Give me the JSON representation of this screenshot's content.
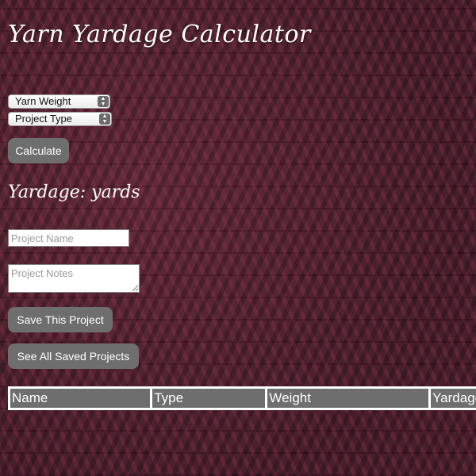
{
  "page": {
    "title": "Yarn Yardage Calculator"
  },
  "form": {
    "yarn_weight_select": {
      "selected": "Yarn Weight"
    },
    "project_type_select": {
      "selected": "Project Type"
    },
    "calculate_label": "Calculate"
  },
  "result": {
    "text": "Yardage: yards"
  },
  "save_form": {
    "project_name_placeholder": "Project Name",
    "project_notes_placeholder": "Project Notes",
    "save_label": "Save This Project",
    "see_all_label": "See All Saved Projects"
  },
  "table": {
    "headers": [
      "Name",
      "Type",
      "Weight",
      "Yardage"
    ]
  },
  "colors": {
    "button_bg": "#6e6e6e",
    "header_bg": "#6e6e6e",
    "background": "#5a2334"
  },
  "icons": {
    "select_arrows": "updown-arrows-icon",
    "resize_handle": "resize-handle-icon"
  }
}
